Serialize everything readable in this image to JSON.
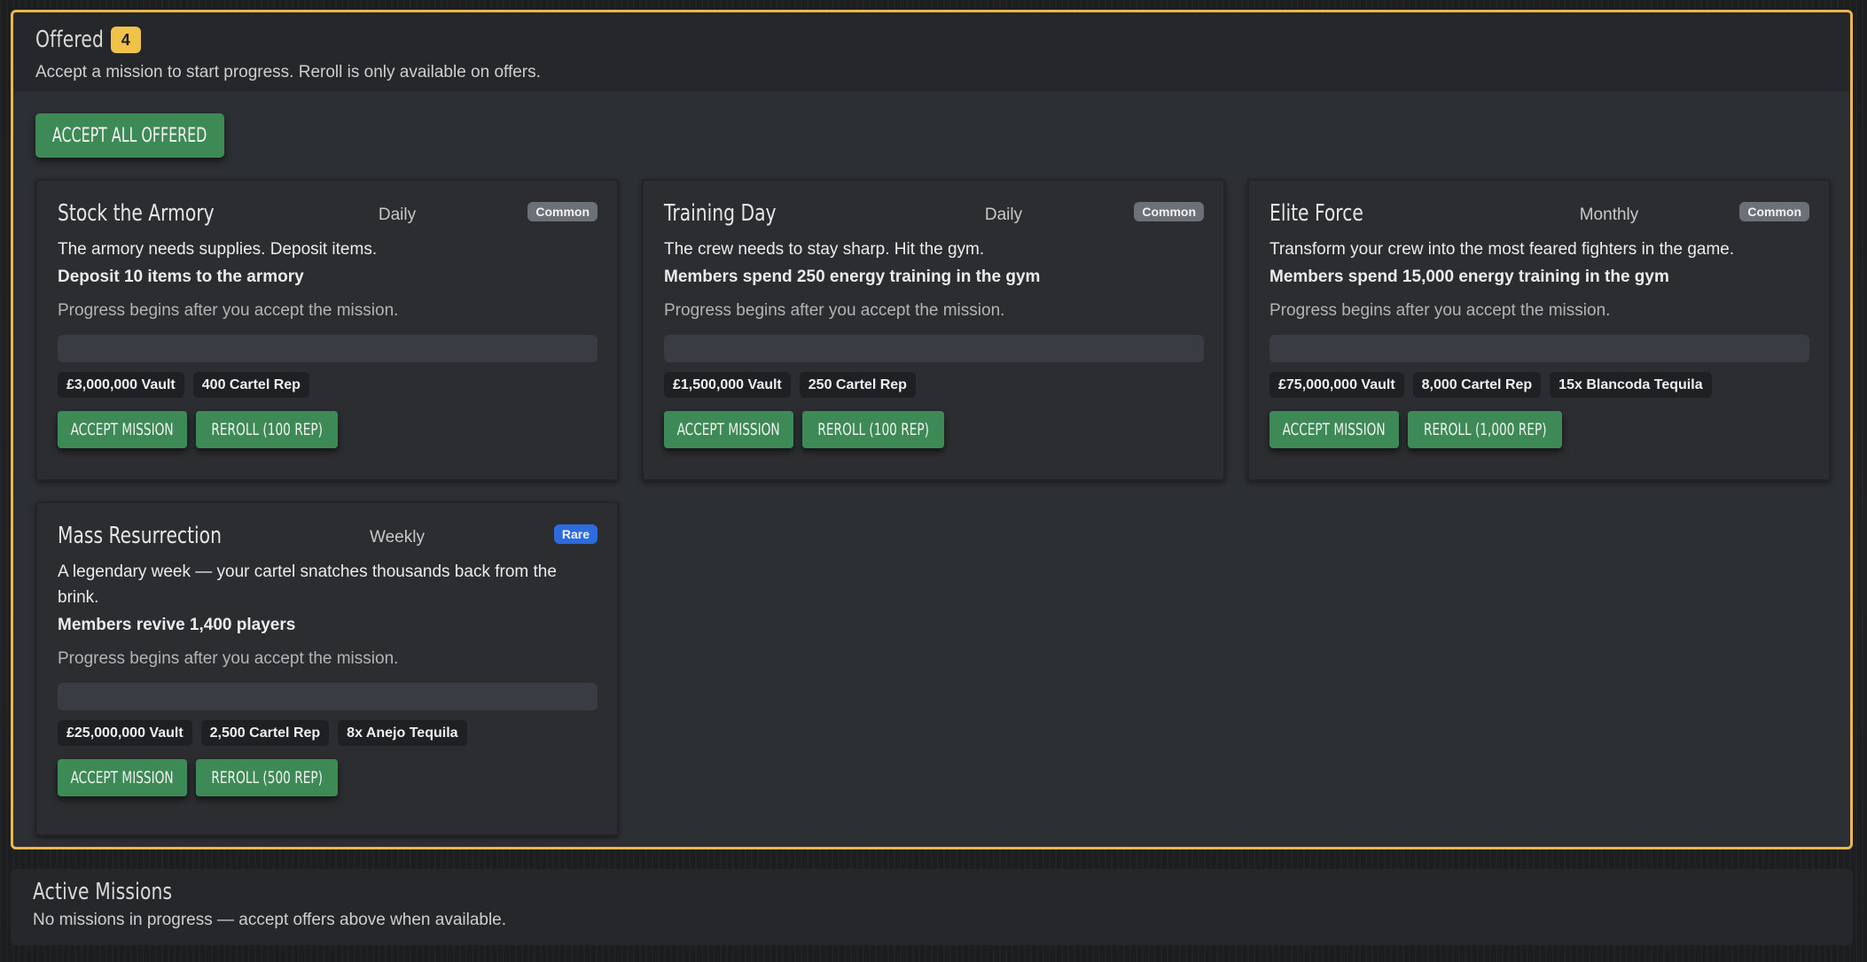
{
  "offered": {
    "title": "Offered",
    "count": "4",
    "subtitle": "Accept a mission to start progress. Reroll is only available on offers.",
    "accept_all_label": "ACCEPT ALL OFFERED"
  },
  "missions": [
    {
      "title": "Stock the Armory",
      "period": "Daily",
      "rarity": "Common",
      "description": "The armory needs supplies. Deposit items.",
      "goal": "Deposit 10 items to the armory",
      "progress_note": "Progress begins after you accept the mission.",
      "progress": 0,
      "rewards": [
        "£3,000,000 Vault",
        "400 Cartel Rep"
      ],
      "accept_label": "ACCEPT MISSION",
      "reroll_label": "REROLL (100 REP)"
    },
    {
      "title": "Training Day",
      "period": "Daily",
      "rarity": "Common",
      "description": "The crew needs to stay sharp. Hit the gym.",
      "goal": "Members spend 250 energy training in the gym",
      "progress_note": "Progress begins after you accept the mission.",
      "progress": 0,
      "rewards": [
        "£1,500,000 Vault",
        "250 Cartel Rep"
      ],
      "accept_label": "ACCEPT MISSION",
      "reroll_label": "REROLL (100 REP)"
    },
    {
      "title": "Elite Force",
      "period": "Monthly",
      "rarity": "Common",
      "description": "Transform your crew into the most feared fighters in the game.",
      "goal": "Members spend 15,000 energy training in the gym",
      "progress_note": "Progress begins after you accept the mission.",
      "progress": 0,
      "rewards": [
        "£75,000,000 Vault",
        "8,000 Cartel Rep",
        "15x Blancoda Tequila"
      ],
      "accept_label": "ACCEPT MISSION",
      "reroll_label": "REROLL (1,000 REP)"
    },
    {
      "title": "Mass Resurrection",
      "period": "Weekly",
      "rarity": "Rare",
      "description": "A legendary week — your cartel snatches thousands back from the brink.",
      "goal": "Members revive 1,400 players",
      "progress_note": "Progress begins after you accept the mission.",
      "progress": 0,
      "rewards": [
        "£25,000,000 Vault",
        "2,500 Cartel Rep",
        "8x Anejo Tequila"
      ],
      "accept_label": "ACCEPT MISSION",
      "reroll_label": "REROLL (500 REP)"
    }
  ],
  "active": {
    "title": "Active Missions",
    "empty_text": "No missions in progress — accept offers above when available."
  },
  "colors": {
    "highlight_border": "#e8b84a",
    "count_badge": "#f0c24a",
    "button_green": "#3e8a57",
    "common_badge": "#6c7077",
    "rare_badge": "#2d6cdf"
  }
}
